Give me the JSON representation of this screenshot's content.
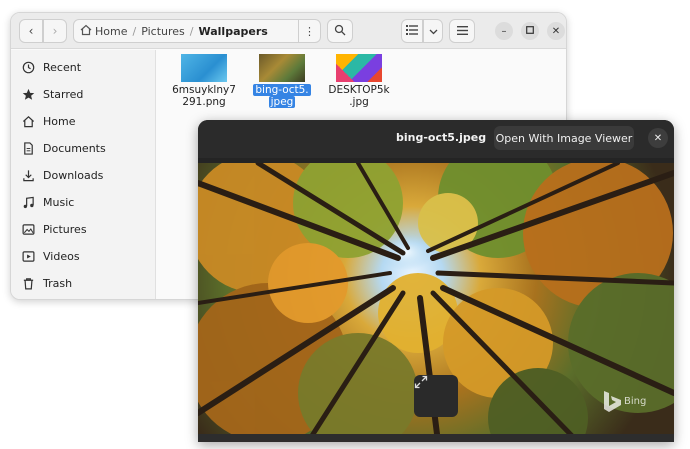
{
  "file_manager": {
    "path": {
      "home": "Home",
      "pictures": "Pictures",
      "current": "Wallpapers"
    },
    "sidebar": {
      "items": [
        {
          "label": "Recent",
          "icon": "clock-icon"
        },
        {
          "label": "Starred",
          "icon": "star-icon"
        },
        {
          "label": "Home",
          "icon": "home-icon"
        },
        {
          "label": "Documents",
          "icon": "document-icon"
        },
        {
          "label": "Downloads",
          "icon": "download-icon"
        },
        {
          "label": "Music",
          "icon": "music-icon"
        },
        {
          "label": "Pictures",
          "icon": "picture-icon"
        },
        {
          "label": "Videos",
          "icon": "video-icon"
        },
        {
          "label": "Trash",
          "icon": "trash-icon"
        }
      ]
    },
    "files": [
      {
        "name_line1": "6msuyklny7",
        "name_line2": "291.png",
        "selected": false
      },
      {
        "name_line1": "bing-oct5.",
        "name_line2": "jpeg",
        "selected": true
      },
      {
        "name_line1": "DESKTOP5k",
        "name_line2": ".jpg",
        "selected": false
      }
    ]
  },
  "image_viewer": {
    "title": "bing-oct5.jpeg",
    "open_button": "Open With Image Viewer",
    "watermark": "Bing"
  },
  "colors": {
    "accent": "#3584e4",
    "viewer_bg": "#242424"
  }
}
